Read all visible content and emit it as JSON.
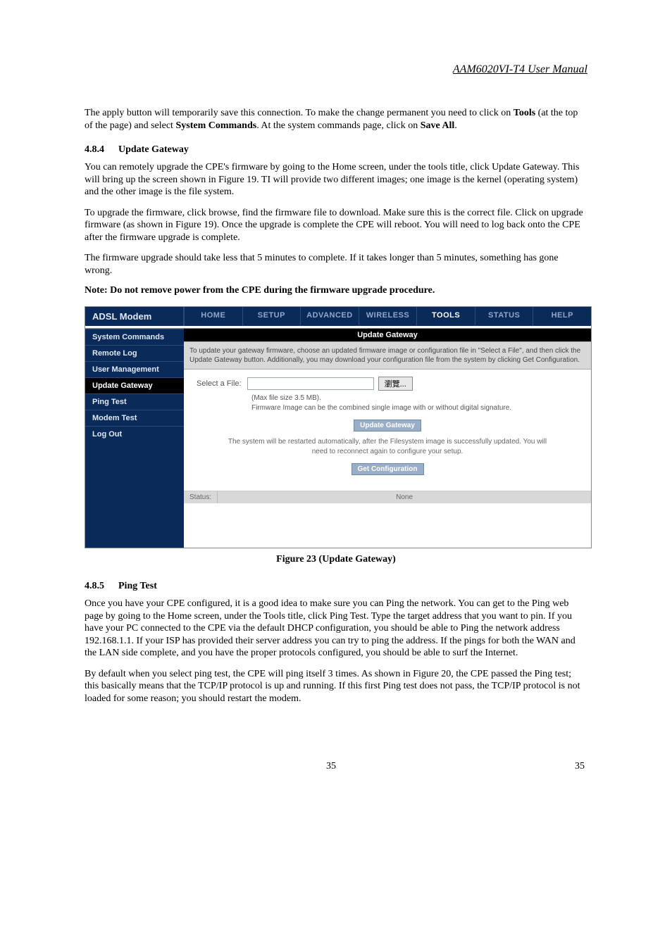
{
  "header": {
    "manual_title": "AAM6020VI-T4 User Manual"
  },
  "intro_para": "The apply button will temporarily save this connection. To make the change permanent you need to click on ",
  "intro_bold1": "Tools",
  "intro_mid": " (at the top of the page) and select ",
  "intro_bold2": "System Commands",
  "intro_tail": ".  At the system commands page, click on ",
  "intro_bold3": "Save All",
  "intro_period": ".",
  "section_484": {
    "num": "4.8.4",
    "title": "Update Gateway"
  },
  "p484_1": "You can remotely upgrade the CPE's firmware by going to the Home screen, under the tools title, click Update Gateway.  This will bring up the screen shown in Figure 19.   TI will provide two different images; one image is the kernel (operating system) and the other image is the file system.",
  "p484_2": "To upgrade the firmware, click browse, find the firmware file to download.  Make sure this is the correct file.  Click on upgrade firmware (as shown in Figure 19).  Once the upgrade is complete the CPE will reboot.  You will need to log back onto the CPE after the firmware upgrade is complete.",
  "p484_3": "The firmware upgrade should take less that 5 minutes to complete.  If it takes longer than 5 minutes, something has gone wrong.",
  "note": "Note: Do not remove power from the CPE during the firmware upgrade procedure.",
  "modem": {
    "brand": "ADSL Modem",
    "tabs": [
      "HOME",
      "SETUP",
      "ADVANCED",
      "WIRELESS",
      "TOOLS",
      "STATUS",
      "HELP"
    ],
    "active_tab": "TOOLS",
    "side": [
      "System Commands",
      "Remote Log",
      "User Management",
      "Update Gateway",
      "Ping Test",
      "Modem Test",
      "Log Out"
    ],
    "side_active": "Update Gateway",
    "banner": "Update Gateway",
    "desc": "To update your gateway firmware, choose an updated firmware image or configuration file in \"Select a File\", and then click the Update Gateway button. Additionally, you may download your configuration file from the system by clicking Get Configuration.",
    "select_label": "Select a File:",
    "browse_label": "瀏覽...",
    "hint1": "(Max file size 3.5 MB).",
    "hint2": "Firmware Image can be the combined single image with or without digital signature.",
    "btn_update": "Update Gateway",
    "smalltext": "The system will be restarted automatically, after the Filesystem image is successfully updated. You will need to reconnect again to configure your setup.",
    "btn_getconf": "Get Configuration",
    "status_label": "Status:",
    "status_value": "None"
  },
  "fig_caption": "Figure 23 (Update Gateway)",
  "section_485": {
    "num": "4.8.5",
    "title": "Ping Test"
  },
  "p485_1": "Once you have your CPE configured, it is a good idea to make sure you can Ping the network.  You can get to the Ping web page by going to the Home screen, under the Tools title, click Ping Test.  Type the target address that you want to pin.  If you have your PC connected to the CPE via the default DHCP configuration, you should be able to Ping the network address 192.168.1.1.  If your ISP has provided their server address you can try to ping the address.  If the pings for both the WAN and the LAN side complete, and you have the proper protocols configured, you should be able to surf the Internet.",
  "p485_2": "By default when you select ping test, the CPE will ping itself 3 times.  As shown in Figure 20, the CPE passed the Ping test; this basically means that the TCP/IP protocol is up and running.  If this first Ping test does not pass, the TCP/IP protocol is not loaded for some reason; you should restart the modem.",
  "footer": {
    "center": "35",
    "right": "35"
  }
}
